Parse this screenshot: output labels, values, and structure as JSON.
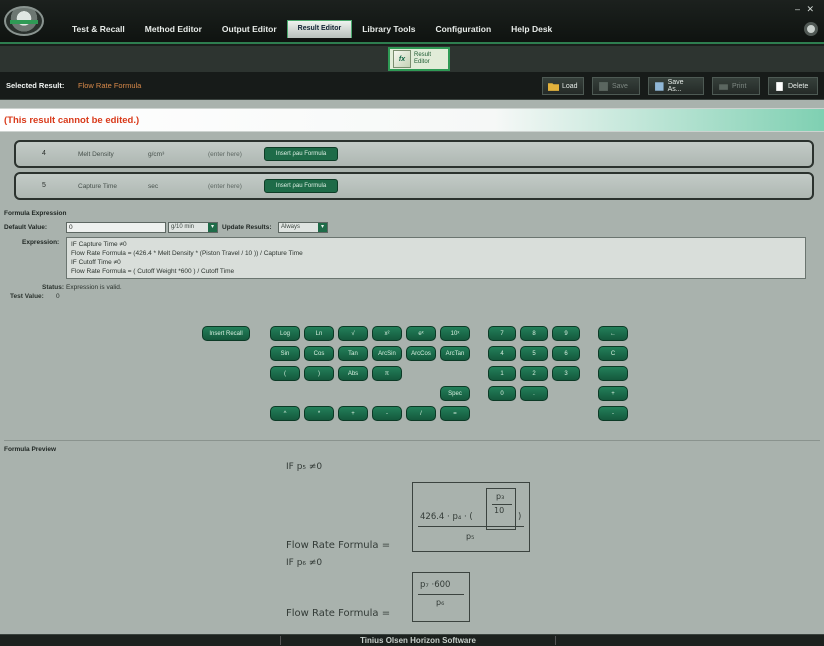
{
  "app": {
    "menu": [
      "Test & Recall",
      "Method Editor",
      "Output Editor",
      "Result Editor",
      "Library Tools",
      "Configuration",
      "Help Desk"
    ],
    "active_menu_index": 3,
    "window_controls": "– ✕",
    "ribbon_button": {
      "icon_text": "fx",
      "label_line1": "Result",
      "label_line2": "Editor"
    }
  },
  "selected_result": {
    "label": "Selected Result:",
    "value": "Flow Rate Formula"
  },
  "toolbar": {
    "load": "Load",
    "save": "Save",
    "save_as": "Save As...",
    "print": "Print",
    "delete": "Delete"
  },
  "warning": "(This result cannot be edited.)",
  "parameters": [
    {
      "num": "4",
      "name": "Melt Density",
      "unit": "g/cm³",
      "field": "(enter here)",
      "button": "Insert ρau Formula"
    },
    {
      "num": "5",
      "name": "Capture Time",
      "unit": "sec",
      "field": "(enter here)",
      "button": "Insert ρau Formula"
    }
  ],
  "expression": {
    "section_title": "Formula Expression",
    "default_value_label": "Default Value:",
    "default_value": "0",
    "unit_select": "g/10 min",
    "update_results_label": "Update Results:",
    "update_results_select": "Always",
    "expression_label": "Expression:",
    "lines": [
      "IF Capture Time ≠0",
      "Flow Rate Formula = (426.4 * Melt Density * (Piston Travel / 10 )) / Capture Time",
      "IF Cutoff Time ≠0",
      "Flow Rate Formula = ( Cutoff Weight *600 ) / Cutoff Time"
    ],
    "status_label": "Status:",
    "status_value": "Expression is valid.",
    "test_value_label": "Test Value:",
    "test_value": "0"
  },
  "keypad": {
    "insert_recall": "Insert Recall",
    "functions": [
      "Log",
      "Ln",
      "√",
      "x²",
      "eˣ",
      "10ˣ",
      "Sin",
      "Cos",
      "Tan",
      "ArcSin",
      "ArcCos",
      "ArcTan",
      "(",
      ")",
      "Abs",
      "π",
      "Spec"
    ],
    "operators": [
      "^",
      "*",
      "+",
      "-",
      "/",
      "="
    ],
    "digits": [
      "7",
      "8",
      "9",
      "4",
      "5",
      "6",
      "1",
      "2",
      "3",
      "0",
      "."
    ],
    "side": [
      "←",
      "C",
      "",
      "+",
      "-"
    ]
  },
  "preview": {
    "title": "Formula Preview",
    "if1": "IF p₅ ≠0",
    "lhs1": "Flow Rate Formula =",
    "num1_prefix": "426.4 · p₄ · (",
    "frac_top": "p₃",
    "frac_bot": "10",
    "num1_suffix": ")",
    "den1": "p₅",
    "if2": "IF p₆ ≠0",
    "lhs2": "Flow Rate Formula =",
    "num2": "p₇ ·600",
    "den2": "p₆"
  },
  "footer": "Tinius Olsen Horizon Software"
}
